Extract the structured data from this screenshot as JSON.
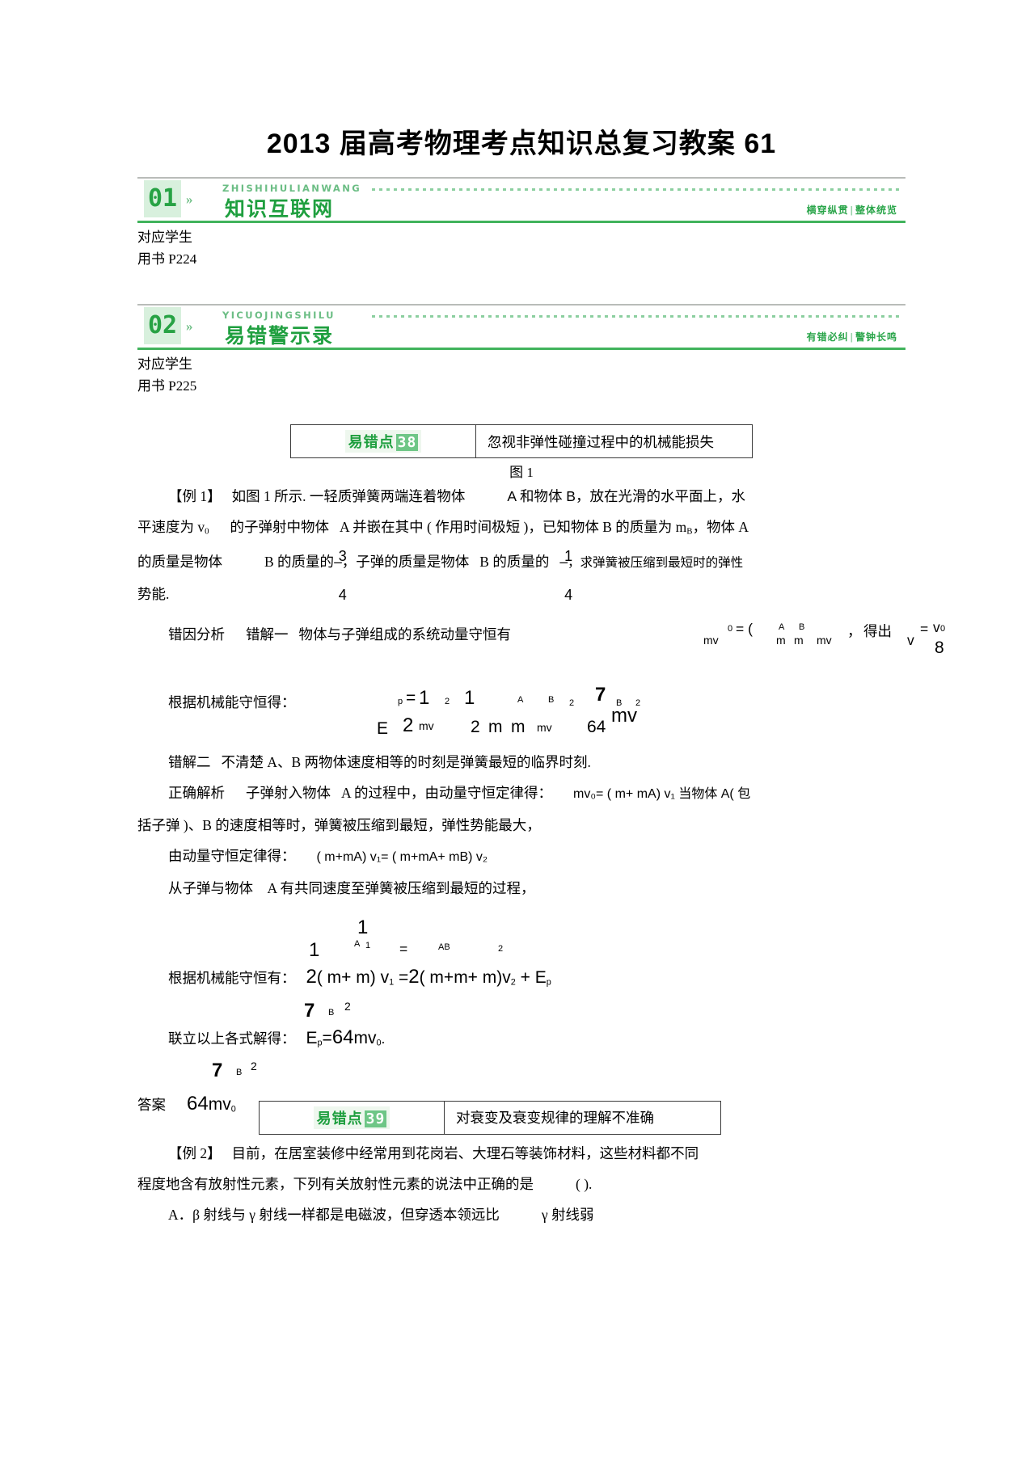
{
  "document": {
    "title": "2013 届高考物理考点知识总复习教案 61"
  },
  "sections": [
    {
      "number": "01",
      "pinyin": "ZHISHIHULIANWANG",
      "name": "知识互联网",
      "motto_left": "横穿纵贯",
      "motto_right": "整体统览",
      "ref_line1": "对应学生",
      "ref_line2": "用书 P224"
    },
    {
      "number": "02",
      "pinyin": "YICUOJINGSHILU",
      "name": "易错警示录",
      "motto_left": "有错必纠",
      "motto_right": "警钟长鸣",
      "ref_line1": "对应学生",
      "ref_line2": "用书 P225"
    }
  ],
  "error_point_38": {
    "tag_label": "易错点",
    "tag_number": "38",
    "title": "忽视非弹性碰撞过程中的机械能损失",
    "figure_caption": "图 1"
  },
  "example1": {
    "label": "【例 1】",
    "line1_a": "如图 1 所示. 一轻质弹簧两端连着物体",
    "line1_b": "A 和物体 B，放在光滑的水平面上，水",
    "line2_a": "平速度为 v",
    "line2_v_sub": "0",
    "line2_b": "的子弹射中物体",
    "line2_c": "A 并嵌在其中 ( 作用时间极短 )，已知物体 B 的质量为 m",
    "line2_m_sub": "B",
    "line2_d": "，物体 A",
    "line3_a": "的质量是物体",
    "line3_b": "B 的质量的",
    "line3_frac1_num": "3",
    "line3_frac1_den": "4",
    "line3_c": "，子弹的质量是物体",
    "line3_d": "B 的质量的",
    "line3_frac2_num": "1",
    "line3_frac2_den": "4",
    "line3_e": "，求弹簧被压缩到最短时的弹性",
    "line4": "势能.",
    "analysis_label": "错因分析",
    "wrong1_label": "错解一",
    "wrong1_text": "物体与子弹组成的系统动量守恒有",
    "wrong1_eq_parts": {
      "mv": "mv",
      "mv_sub": "0",
      "eq_open": "= (",
      "m1": "m",
      "m1_sub": "A",
      "m2": "m",
      "m2_sub": "B",
      "mv2": "mv",
      "comma": "，",
      "deduce": "得出",
      "v": "v",
      "eq2": "=",
      "v0": "v",
      "v0_sub": "0",
      "denom": "8"
    },
    "energy_label": "根据机械能守恒得：",
    "energy_eq_parts": {
      "E": "E",
      "E_sub": "p",
      "eq": "=",
      "one_a": "1",
      "two_a": "2",
      "mv_a": "mv",
      "sub2_a": "2",
      "one_b": "1",
      "two_b": "2",
      "m_b": "m",
      "mA": "A",
      "m_c": "m",
      "mB": "B",
      "mv_b": "mv",
      "sub2_b": "2",
      "frac7": "7",
      "frac64": "64",
      "mv_c": "mv",
      "mB2": "B",
      "sup2": "2"
    },
    "wrong2_label": "错解二",
    "wrong2_text": "不清楚 A、B 两物体速度相等的时刻是弹簧最短的临界时刻.",
    "correct_label": "正确解析",
    "correct_line1_a": "子弹射入物体",
    "correct_line1_b": "A 的过程中，由动量守恒定律得：",
    "correct_line1_eq": "mv₀= ( m+ mA) v₁ 当物体 A( 包",
    "correct_line2": "括子弹 )、B 的速度相等时，弹簧被压缩到最短，弹性势能最大，",
    "correct_line3_label": "由动量守恒定律得：",
    "correct_line3_eq": "( m+mA) v₁= ( m+mA+ mB) v₂",
    "correct_line4": "从子弹与物体　A 有共同速度至弹簧被压缩到最短的过程，",
    "energy2_label": "根据机械能守恒有：",
    "energy2_eq_parts": {
      "half1": "1",
      "two1": "2",
      "open1": "( m+ m",
      "subA": "A",
      "close1": ") v",
      "sub1": "1",
      "eq": "=",
      "half2": "1",
      "two2": "2",
      "open2": "( m+m+ m)",
      "subAB": "AB",
      "v2": "v",
      "sub2": "2",
      "plus": "+ E",
      "subp": "p"
    },
    "solve_label": "联立以上各式解得：",
    "solve_eq": {
      "E": "E",
      "E_sub": "p",
      "eq": "=",
      "frac_num": "7",
      "frac_den": "64",
      "mv": "mv",
      "mv_sub": "0",
      "mB": "B",
      "sup": "2",
      "period": "."
    },
    "answer_label": "答案",
    "answer_value": {
      "frac_num": "7",
      "frac_den": "64",
      "mv": "mv",
      "mv_sub": "0",
      "mB": "B",
      "sup": "2"
    }
  },
  "error_point_39": {
    "tag_label": "易错点",
    "tag_number": "39",
    "title": "对衰变及衰变规律的理解不准确"
  },
  "example2": {
    "label": "【例 2】",
    "line1": "目前，在居室装修中经常用到花岗岩、大理石等装饰材料，这些材料都不同",
    "line2_a": "程度地含有放射性元素，下列有关放射性元素的说法中正确的是",
    "line2_b": "( ).",
    "option_a_a": "A．β 射线与 γ 射线一样都是电磁波，但穿透本领远比",
    "option_a_b": "γ 射线弱"
  }
}
